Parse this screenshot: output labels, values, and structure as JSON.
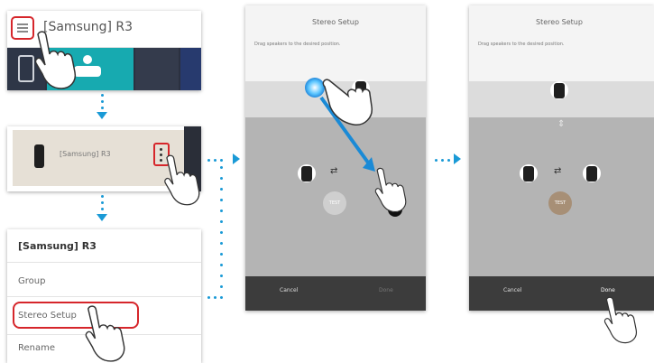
{
  "panel1": {
    "title": "[Samsung] R3"
  },
  "panel2": {
    "speaker_name": "[Samsung] R3"
  },
  "panel3": {
    "title": "[Samsung] R3",
    "items": [
      "Group",
      "Stereo Setup",
      "Rename"
    ]
  },
  "phone_before": {
    "title": "Stereo Setup",
    "instruction": "Drag speakers to the desired position.",
    "test_label": "TEST",
    "cancel_label": "Cancel",
    "done_label": "Done",
    "step1": "1",
    "step2": "2"
  },
  "phone_after": {
    "title": "Stereo Setup",
    "instruction": "Drag speakers to the desired position.",
    "test_label": "TEST",
    "cancel_label": "Cancel",
    "done_label": "Done"
  },
  "colors": {
    "accent_blue": "#1a9ad6",
    "highlight_red": "#d6262b",
    "test_active": "#a78f76",
    "test_inactive": "#cfcfcf"
  }
}
